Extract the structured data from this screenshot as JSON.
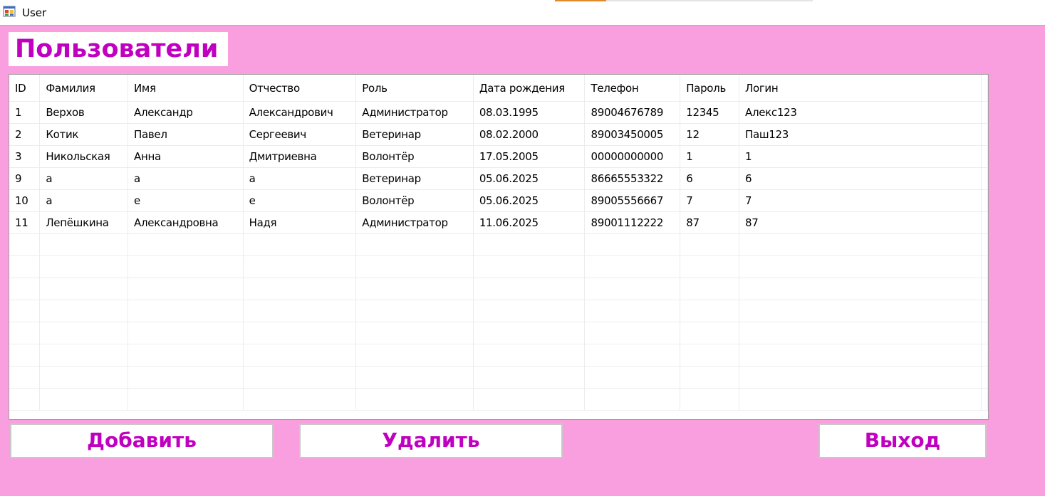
{
  "window": {
    "title": "User"
  },
  "page": {
    "title": "Пользователи"
  },
  "grid": {
    "columns": [
      "ID",
      "Фамилия",
      "Имя",
      "Отчество",
      "Роль",
      "Дата рождения",
      "Телефон",
      "Пароль",
      "Логин"
    ],
    "rows": [
      [
        "1",
        "Верхов",
        "Александр",
        "Александрович",
        "Администратор",
        "08.03.1995",
        "89004676789",
        "12345",
        "Алекс123"
      ],
      [
        "2",
        "Котик",
        "Павел",
        "Сергеевич",
        "Ветеринар",
        "08.02.2000",
        "89003450005",
        "12",
        "Паш123"
      ],
      [
        "3",
        "Никольская",
        "Анна",
        "Дмитриевна",
        "Волонтёр",
        "17.05.2005",
        "00000000000",
        "1",
        "1"
      ],
      [
        "9",
        "а",
        "а",
        "а",
        "Ветеринар",
        "05.06.2025",
        "86665553322",
        "6",
        "6"
      ],
      [
        "10",
        "а",
        "е",
        "е",
        "Волонтёр",
        "05.06.2025",
        "89005556667",
        "7",
        "7"
      ],
      [
        "11",
        "Лепёшкина",
        "Александровна",
        "Надя",
        "Администратор",
        "11.06.2025",
        "89001112222",
        "87",
        "87"
      ]
    ]
  },
  "buttons": {
    "add": "Добавить",
    "delete": "Удалить",
    "exit": "Выход"
  },
  "colors": {
    "background": "#f99ede",
    "accent_text": "#c000c0"
  },
  "icons": {
    "app": "app-window-icon"
  }
}
